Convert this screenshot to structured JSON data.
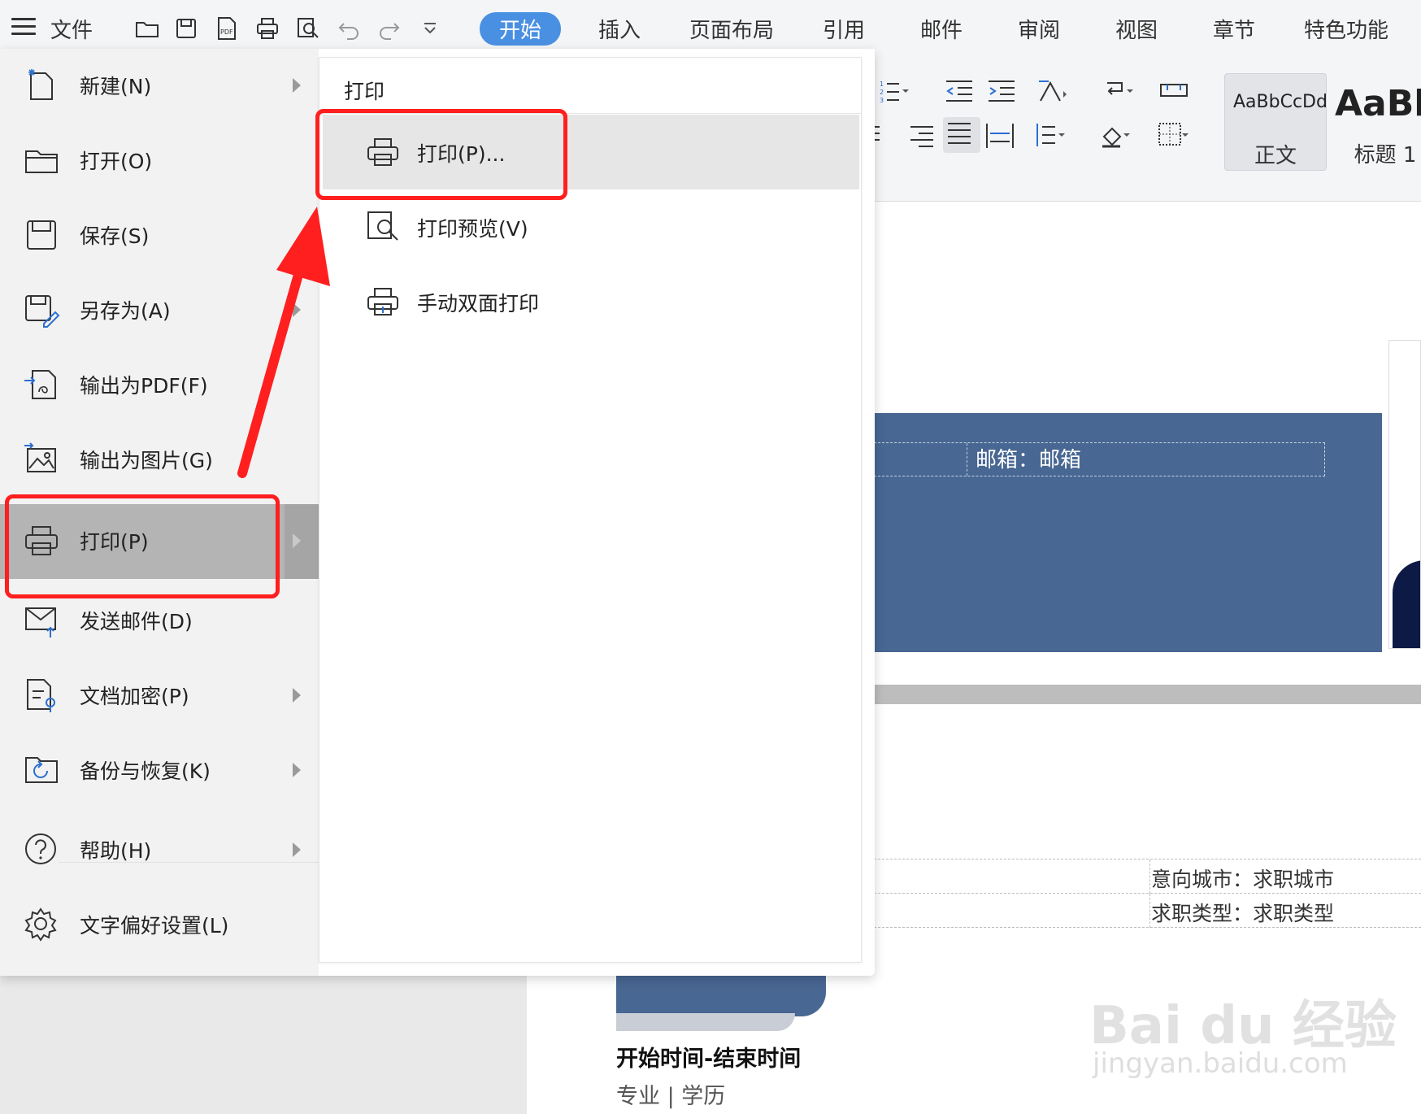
{
  "menubar": {
    "file_label": "文件",
    "tabs": [
      {
        "label": "开始",
        "active": true
      },
      {
        "label": "插入"
      },
      {
        "label": "页面布局"
      },
      {
        "label": "引用"
      },
      {
        "label": "邮件"
      },
      {
        "label": "审阅"
      },
      {
        "label": "视图"
      },
      {
        "label": "章节"
      },
      {
        "label": "特色功能"
      }
    ]
  },
  "ribbon": {
    "styles": [
      {
        "sample": "AaBbCcDd",
        "name": "正文"
      },
      {
        "sample": "AaBb",
        "name": "标题 1"
      }
    ]
  },
  "file_menu": {
    "items": [
      {
        "label": "新建(N)",
        "icon": "new-file-icon",
        "has_submenu": true
      },
      {
        "label": "打开(O)",
        "icon": "folder-open-icon",
        "has_submenu": false
      },
      {
        "label": "保存(S)",
        "icon": "save-icon",
        "has_submenu": false
      },
      {
        "label": "另存为(A)",
        "icon": "save-as-icon",
        "has_submenu": true
      },
      {
        "label": "输出为PDF(F)",
        "icon": "export-pdf-icon",
        "has_submenu": false
      },
      {
        "label": "输出为图片(G)",
        "icon": "export-image-icon",
        "has_submenu": false
      },
      {
        "label": "打印(P)",
        "icon": "printer-icon",
        "has_submenu": true,
        "active": true
      },
      {
        "label": "发送邮件(D)",
        "icon": "mail-icon",
        "has_submenu": false
      },
      {
        "label": "文档加密(P)",
        "icon": "encrypt-icon",
        "has_submenu": true
      },
      {
        "label": "备份与恢复(K)",
        "icon": "backup-icon",
        "has_submenu": true
      },
      {
        "label": "帮助(H)",
        "icon": "help-icon",
        "has_submenu": true
      },
      {
        "label": "文字偏好设置(L)",
        "icon": "gear-icon",
        "has_submenu": false
      }
    ]
  },
  "print_submenu": {
    "title": "打印",
    "items": [
      {
        "label": "打印(P)...",
        "icon": "printer-icon",
        "active": true
      },
      {
        "label": "打印预览(V)",
        "icon": "print-preview-icon"
      },
      {
        "label": "手动双面打印",
        "icon": "duplex-print-icon"
      }
    ]
  },
  "document": {
    "email_line": "邮箱：邮箱",
    "city_line": "意向城市：求职城市",
    "type_line": "求职类型：求职类型",
    "time_range": "开始时间-结束时间",
    "major_line": "专业 | 学历"
  },
  "watermark": {
    "main": "Bai du 经验",
    "sub": "jingyan.baidu.com"
  },
  "colors": {
    "accent": "#4a90e2",
    "resume_blue": "#486792",
    "highlight_red": "#ff1f1f"
  }
}
